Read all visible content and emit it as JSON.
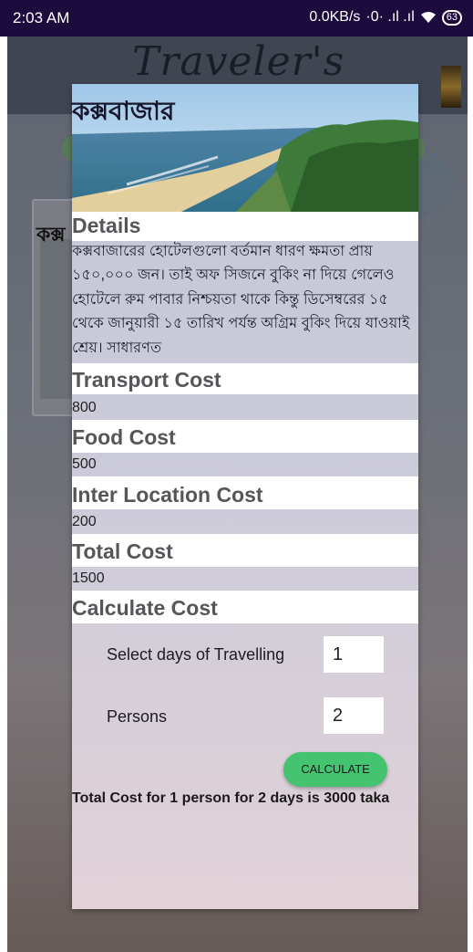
{
  "status_bar": {
    "time": "2:03 AM",
    "net_speed": "0.0KB/s",
    "battery": "63"
  },
  "app": {
    "title": "Traveler's",
    "card_peek_text": "কক্স"
  },
  "dialog": {
    "title": "কক্সবাজার",
    "details_label": "Details",
    "details_text": "কক্সবাজারের হোটেলগুলো বর্তমান ধারণ ক্ষমতা প্রায় ১৫০,০০০ জন। তাই অফ সিজনে বুকিং না দিয়ে গেলেও হোটেলে রুম পাবার নিশ্চয়তা থাকে কিন্তু ডিসেম্বরের ১৫ থেকে জানুয়ারী ১৫ তারিখ পর্যন্ত অগ্রিম বুকিং দিয়ে যাওয়াই শ্রেয়। সাধারণত",
    "transport_label": "Transport Cost",
    "transport_value": "800",
    "food_label": "Food Cost",
    "food_value": "500",
    "inter_label": "Inter Location Cost",
    "inter_value": "200",
    "total_label": "Total Cost",
    "total_value": "1500",
    "calc_label": "Calculate Cost",
    "days_label": "Select days of Travelling",
    "days_value": "1",
    "persons_label": "Persons",
    "persons_value": "2",
    "calculate_button": "CALCULATE",
    "result_text": "Total Cost for 1 person for 2 days is 3000 taka"
  },
  "colors": {
    "status_bar": "#1b0c3d",
    "button": "#44c470",
    "strip": "#ffffff"
  },
  "icons": [
    "signal-icon",
    "wifi-icon",
    "battery-icon",
    "beach-photo"
  ]
}
